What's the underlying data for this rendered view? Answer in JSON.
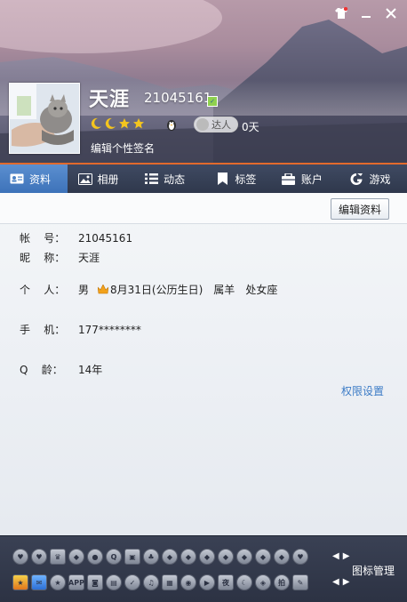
{
  "header": {
    "name": "天涯",
    "qq_number": "21045161",
    "daren_label": "达人",
    "days": "0天",
    "signature_placeholder": "编辑个性签名"
  },
  "tabs": [
    {
      "label": "资料",
      "icon": "profile-card-icon",
      "active": true
    },
    {
      "label": "相册",
      "icon": "photo-icon",
      "active": false
    },
    {
      "label": "动态",
      "icon": "feed-list-icon",
      "active": false
    },
    {
      "label": "标签",
      "icon": "bookmark-icon",
      "active": false
    },
    {
      "label": "账户",
      "icon": "wallet-icon",
      "active": false
    },
    {
      "label": "游戏",
      "icon": "game-icon",
      "active": false
    }
  ],
  "toolbar": {
    "edit_label": "编辑资料"
  },
  "profile": {
    "account_label": "帐    号：",
    "account": "21045161",
    "nickname_label": "昵    称：",
    "nickname": "天涯",
    "personal_label": "个    人：",
    "gender": "男",
    "birthday": "8月31日(公历生日)",
    "zodiac": "属羊",
    "constellation": "处女座",
    "phone_label": "手    机：",
    "phone": "177********",
    "qage_label": "Q    龄：",
    "qage": "14年"
  },
  "permissions_link": "权限设置",
  "icon_manager": "图标管理",
  "colors": {
    "accent": "#e26a2c",
    "tab_active": "#4a80c4",
    "link": "#3b7bc6"
  }
}
